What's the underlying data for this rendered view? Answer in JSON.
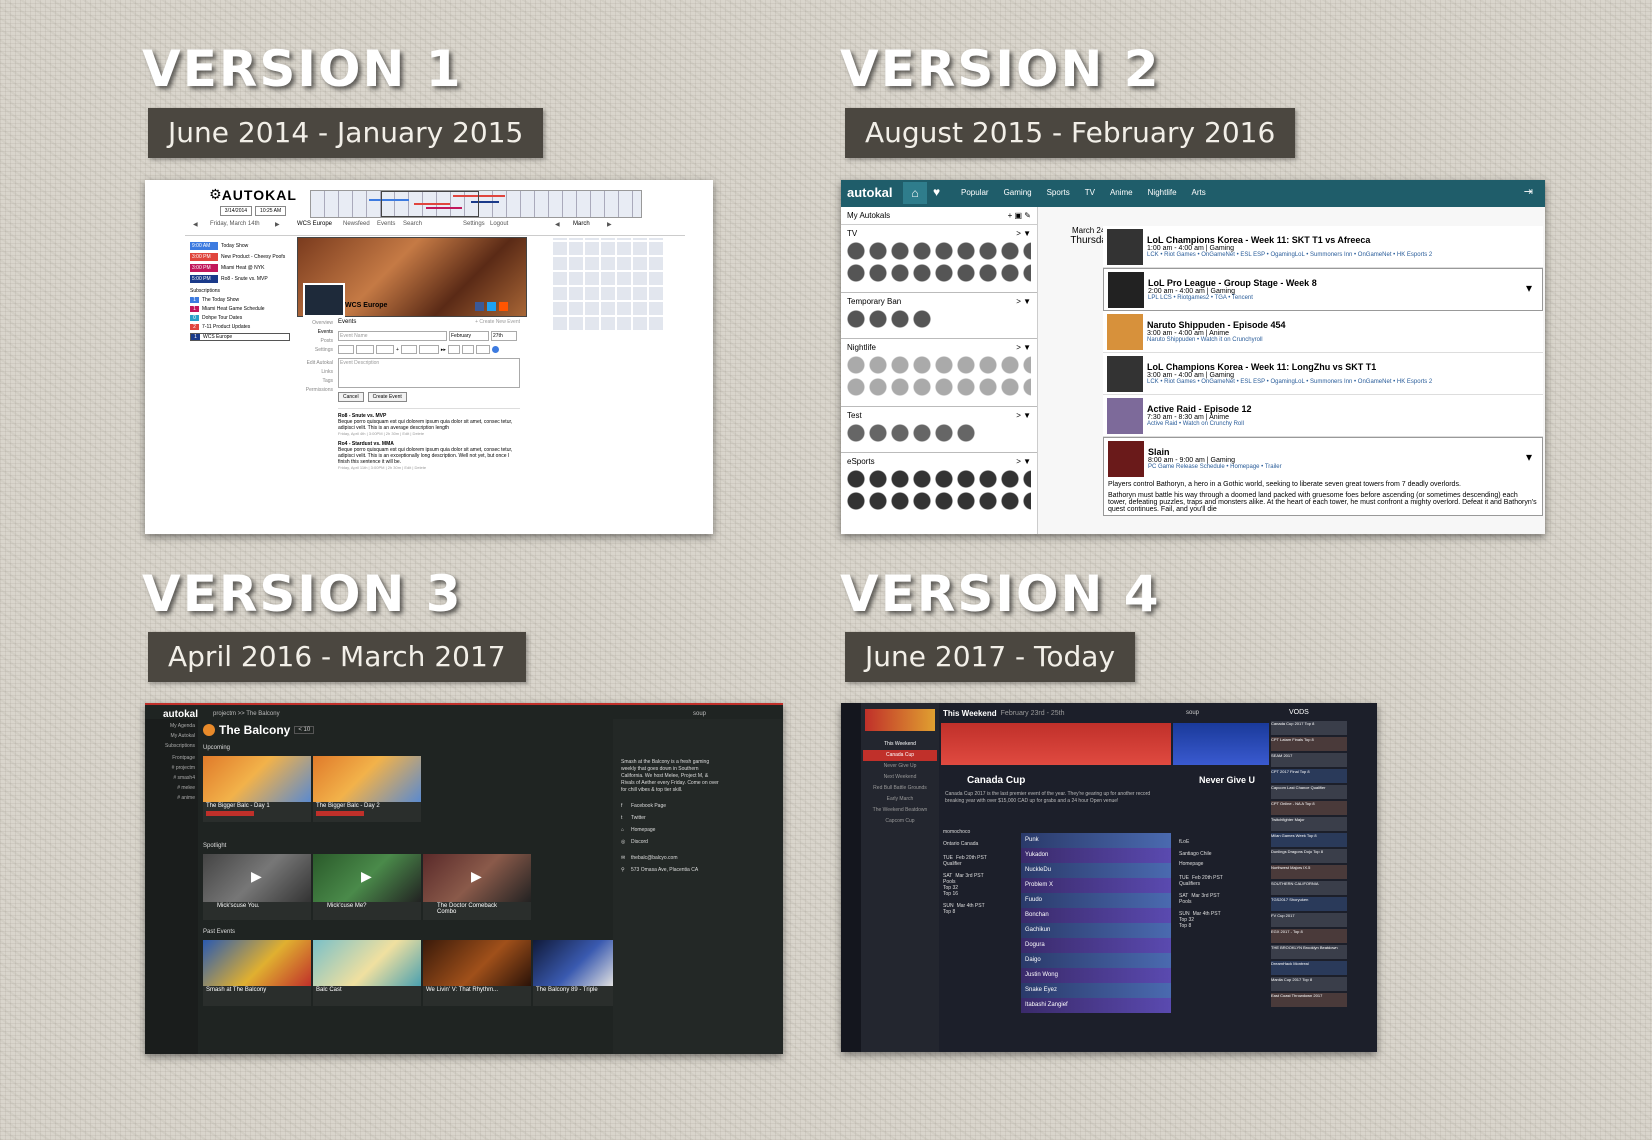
{
  "versions": [
    {
      "title": "VERSION 1",
      "dates": "June 2014 - January 2015"
    },
    {
      "title": "VERSION 2",
      "dates": "August 2015 - February 2016"
    },
    {
      "title": "VERSION 3",
      "dates": "April 2016 - March 2017"
    },
    {
      "title": "VERSION 4",
      "dates": "June 2017 - Today"
    }
  ],
  "v1": {
    "logo": "AUTOKAL",
    "date_field": "3/14/2014",
    "time_field": "10:25 AM",
    "day_label": "Friday, March 14th",
    "month_label": "March",
    "tabs": [
      "WCS Europe",
      "Newsfeed",
      "Events",
      "Search",
      "Settings",
      "Logout"
    ],
    "agenda": [
      {
        "time": "9:00 AM",
        "title": "Today Show",
        "color": "#3d7be0"
      },
      {
        "time": "3:00 PM",
        "title": "New Product - Cheesy Poofs",
        "color": "#e0453d"
      },
      {
        "time": "3:00 PM",
        "title": "Miami Heat @ NYK",
        "color": "#c2185b"
      },
      {
        "time": "5:00 PM",
        "title": "Ro8 - Snute vs. MVP",
        "color": "#1a3a8a"
      }
    ],
    "subscriptions_title": "Subscriptions",
    "subscriptions": [
      {
        "num": "1",
        "name": "The Today Show",
        "color": "#3d7be0"
      },
      {
        "num": "1",
        "name": "Miami Heat Game Schedule",
        "color": "#c2185b"
      },
      {
        "num": "0",
        "name": "Dohpe Tour Dates",
        "color": "#2aa0c8"
      },
      {
        "num": "2",
        "name": "7-11 Product Updates",
        "color": "#e0453d"
      },
      {
        "num": "1",
        "name": "WCS Europe",
        "color": "#1a3a8a"
      }
    ],
    "page_name": "WCS Europe",
    "side_links": [
      "Overview",
      "Events",
      "Posts",
      "Settings",
      "Edit Autokal",
      "Links",
      "Tags",
      "Permissions"
    ],
    "events_title": "Events",
    "create_link": "+ Create New Event",
    "event_name_placeholder": "Event Name",
    "month_select": "February",
    "day_select": "27th",
    "desc_placeholder": "Event Description",
    "cancel_label": "Cancel",
    "create_label": "Create Event",
    "posts": [
      {
        "title": "Ro8 - Snute vs. MVP",
        "body": "Beque porro quisquam est qui dolorem ipsum quia dolor sit amet, consec tetur, adipisci velit. This is an average description length",
        "meta": "Friday, April 4th | 3:00PM | 2h 30m | Edit | Delete"
      },
      {
        "title": "Ro4 - Stardust vs. MMA",
        "body": "Beque porro quisquam est qui dolorem ipsum quia dolor sit amet, consec tetur, adipisci velit. This is an exceptionally long description. Well not yet, but once I finish this sentence it will be.",
        "meta": "Friday, April 11th | 3:00PM | 2h 30m | Edit | Delete"
      }
    ]
  },
  "v2": {
    "logo": "autokal",
    "nav": [
      "Popular",
      "Gaming",
      "Sports",
      "TV",
      "Anime",
      "Nightlife",
      "Arts"
    ],
    "panel_title": "My Autokals",
    "groups": [
      "TV",
      "Temporary Ban",
      "Nightlife",
      "Test",
      "eSports"
    ],
    "date_label": "March 24th",
    "day_label": "Thursday",
    "events": [
      {
        "title": "LoL Champions Korea - Week 11: SKT T1 vs Afreeca",
        "time": "1:00 am - 4:00 am | Gaming",
        "links": "LCK • Riot Games • OnGameNet • ESL ESP • OgamingLoL • Summoners Inn • OnGameNet • HK Esports 2"
      },
      {
        "title": "LoL Pro League - Group Stage - Week 8",
        "time": "2:00 am - 4:00 am | Gaming",
        "links": "LPL LCS • Riotgames2 • TGA • Tencent"
      },
      {
        "title": "Naruto Shippuden - Episode 454",
        "time": "3:00 am - 4:00 am | Anime",
        "links": "Naruto Shippuden • Watch it on Crunchyroll"
      },
      {
        "title": "LoL Champions Korea - Week 11: LongZhu vs SKT T1",
        "time": "3:00 am - 4:00 am | Gaming",
        "links": "LCK • Riot Games • OnGameNet • ESL ESP • OgamingLoL • Summoners Inn • OnGameNet • HK Esports 2"
      },
      {
        "title": "Active Raid - Episode 12",
        "time": "7:30 am - 8:30 am | Anime",
        "links": "Active Raid • Watch on Crunchy Roll"
      },
      {
        "title": "Slain",
        "time": "8:00 am - 9:00 am | Gaming",
        "links": "PC Game Release Schedule • Homepage • Trailer"
      }
    ],
    "desc1": "Players control Bathoryn, a hero in a Gothic world, seeking to liberate seven great towers from 7 deadly overlords.",
    "desc2": "Bathoryn must battle his way through a doomed land packed with gruesome foes before ascending (or sometimes descending) each tower, defeating puzzles, traps and monsters alike. At the heart of each tower, he must confront a mighty overlord. Defeat it and Bathoryn's quest continues. Fail, and you'll die"
  },
  "v3": {
    "logo": "autokal",
    "breadcrumb": "projectm >> The Balcony",
    "user": "soup",
    "side_links": [
      "My Agenda",
      "My Autokal",
      "Subscriptions",
      "Frontpage",
      "# projectm",
      "# smash4",
      "# melee",
      "# anime"
    ],
    "page_title": "The Balcony",
    "member_count": "< 10",
    "upcoming_title": "Upcoming",
    "upcoming": [
      {
        "title": "The Bigger Balc - Day 1",
        "date": "May 27th",
        "sub": "Saturday • 11:00am",
        "tag": "projectm"
      },
      {
        "title": "The Bigger Balc - Day 2",
        "date": "May 28th",
        "sub": "Sunday • 11:00am",
        "tag": "projectm"
      }
    ],
    "spotlight_title": "Spotlight",
    "spotlight": [
      {
        "title": "Mick'scuse You.",
        "sub": "12 days ago"
      },
      {
        "title": "Mick'cuse Me?",
        "sub": "12 days ago"
      },
      {
        "title": "The Doctor Comeback Combo",
        "sub": "12 days ago"
      }
    ],
    "past_title": "Past Events",
    "past": [
      {
        "title": "Smash at The Balcony",
        "date": "Apr 1st",
        "sub": "Saturday • 4:00pm"
      },
      {
        "title": "Balc Cast",
        "date": "Mar 30th",
        "sub": "Saturday • 4:00pm"
      },
      {
        "title": "We Livin' V: That Rhythm...",
        "date": "Mar 26th",
        "sub": "Sunday • Noon"
      },
      {
        "title": "The Balcony 89 - Triple",
        "date": "Mar 25th",
        "sub": "Saturday • 4:00pm"
      }
    ],
    "about": "Smash at the Balcony is a fresh gaming weekly that goes down in Southern California. We host Melee, Project M, & Rivals of Aether every Friday. Come on over for chill vibes & top tier skill.",
    "links": [
      "Facebook Page",
      "Twitter",
      "Homepage",
      "Discord"
    ],
    "email": "thebalc@balcyo.com",
    "address": "573 Omasa Ave, Placentia CA"
  },
  "v4": {
    "header": "This Weekend",
    "header_dates": "February 23rd - 25th",
    "user": "soup",
    "vods_title": "VODS",
    "side_items": [
      "This Weekend",
      "Canada Cup",
      "Never Give Up",
      "Next Weekend",
      "Red Bull Battle Grounds",
      "Early March",
      "The Weekend Beatdown",
      "Capcom Cup"
    ],
    "canada": {
      "name": "Canada Cup",
      "desc": "Canada Cup 2017 is the last premier event of the year. They're gearing up for another record breaking year with over $15,000 CAD up for grabs and a 24 hour Open venue!",
      "streamer": "momochoco",
      "location": "Ontario Canada",
      "schedule": [
        {
          "day": "TUE",
          "date": "Feb 20th PST",
          "label": "Qualifier"
        },
        {
          "day": "SAT",
          "date": "Mar 3rd PST",
          "label": "Pools"
        },
        {
          "day": "SAT",
          "date": "",
          "label": "Top 32"
        },
        {
          "day": "",
          "date": "",
          "label": "Top 16"
        },
        {
          "day": "SUN",
          "date": "Mar 4th PST",
          "label": "Top 8"
        }
      ]
    },
    "players": [
      "Punk",
      "Yukadon",
      "NuckleDu",
      "Problem X",
      "Fuudo",
      "Bonchan",
      "Gachikun",
      "Dogura",
      "Daigo",
      "Justin Wong",
      "Snake Eyez",
      "Itabashi Zangief"
    ],
    "ngu": {
      "name": "Never Give U",
      "streamer": "fLoE",
      "location": "Santiago Chile",
      "homepage": "Homepage",
      "schedule": [
        {
          "day": "TUE",
          "date": "Feb 20th PST",
          "label": "Qualifiers"
        },
        {
          "day": "SAT",
          "date": "Mar 3rd PST",
          "label": "Pools"
        },
        {
          "day": "SUN",
          "date": "Mar 4th PST",
          "label": "Top 32"
        },
        {
          "day": "",
          "date": "",
          "label": "Top 8"
        }
      ]
    },
    "vods": [
      "Canada Cup 2017 Top 8",
      "CPT Latam Finals Top 8",
      "SEAM 2017",
      "CPT 2017 Final Top 8",
      "Capcom Last Chance Qualifier",
      "CPT Online - NA A Top 8",
      "Twitchfighter Major",
      "Milan Games Week Top 8",
      "Dunlings Dragons Dojo Top 8",
      "Northwest Majors IX.5",
      "SOUTHERN CALIFORNIA",
      "TGS2017 Shoryuken",
      "FV Cup 2017",
      "EGX 2017 - Top 8",
      "THE BROOKLYN Brooklyn Beatdown",
      "DreamHack Montreal",
      "Manila Cup 2017 Top 8",
      "East Coast Throwdown 2017"
    ]
  }
}
